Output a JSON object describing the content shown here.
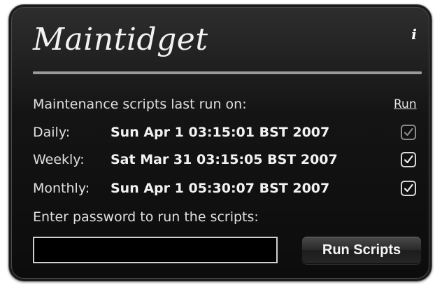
{
  "widget": {
    "title": "Maintidget",
    "info_label": "i"
  },
  "scripts": {
    "header": "Maintenance scripts last run on:",
    "run_column_label": "Run",
    "rows": [
      {
        "label": "Daily:",
        "last_run": "Sun Apr 1 03:15:01 BST 2007",
        "run_checked": true
      },
      {
        "label": "Weekly:",
        "last_run": "Sat Mar 31 03:15:05 BST 2007",
        "run_checked": true
      },
      {
        "label": "Monthly:",
        "last_run": "Sun Apr 1 05:30:07 BST 2007",
        "run_checked": true
      }
    ]
  },
  "password": {
    "prompt": "Enter password to run the scripts:",
    "value": ""
  },
  "run_button_label": "Run Scripts",
  "colors": {
    "widget_background": "#141414",
    "text": "#e0e0e0",
    "rule": "#9a9a9a"
  }
}
